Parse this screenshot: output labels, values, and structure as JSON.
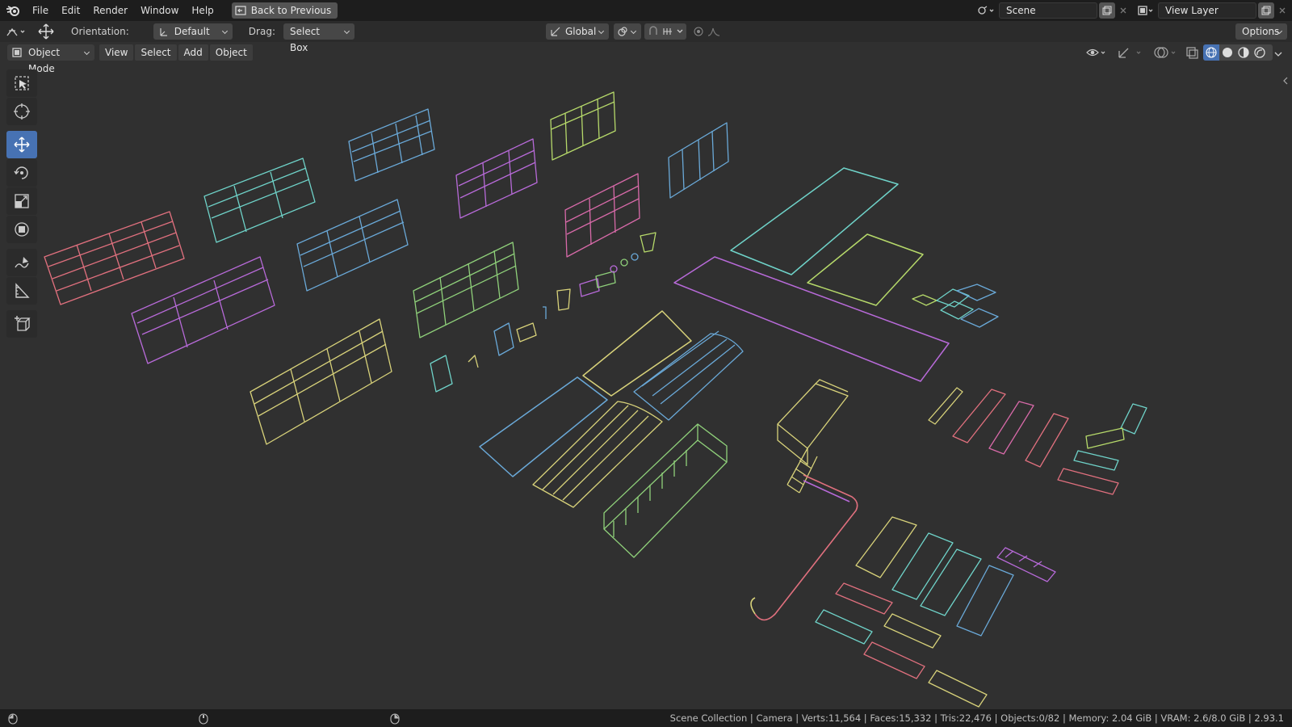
{
  "topbar": {
    "menus": [
      "File",
      "Edit",
      "Render",
      "Window",
      "Help"
    ],
    "back_button": "Back to Previous",
    "scene_name": "Scene",
    "view_layer": "View Layer"
  },
  "toolheader": {
    "orientation_label": "Orientation:",
    "orientation_value": "Default",
    "drag_label": "Drag:",
    "drag_value": "Select Box",
    "transform_space": "Global",
    "options": "Options"
  },
  "viewport_header": {
    "mode": "Object Mode",
    "menus": [
      "View",
      "Select",
      "Add",
      "Object"
    ]
  },
  "toolbar": {
    "tools": [
      "select-box-icon",
      "cursor-icon",
      "move-icon",
      "rotate-icon",
      "scale-icon",
      "transform-icon",
      "annotate-icon",
      "measure-icon",
      "add-cube-icon"
    ],
    "active": "move-icon"
  },
  "statusbar": {
    "text": "Scene Collection | Camera | Verts:11,564 | Faces:15,332 | Tris:22,476 | Objects:0/82 | Memory: 2.04 GiB | VRAM: 2.6/8.0 GiB | 2.93.1"
  },
  "colors": {
    "background": "#303030",
    "active_tool": "#4772b3",
    "wire_pink": "#e0707e",
    "wire_cyan": "#6fd3c9",
    "wire_blue": "#6aa9d8",
    "wire_purple": "#b86ad9",
    "wire_green": "#8fd07a",
    "wire_yellow": "#d8d27a",
    "wire_lime": "#b6d96a"
  }
}
